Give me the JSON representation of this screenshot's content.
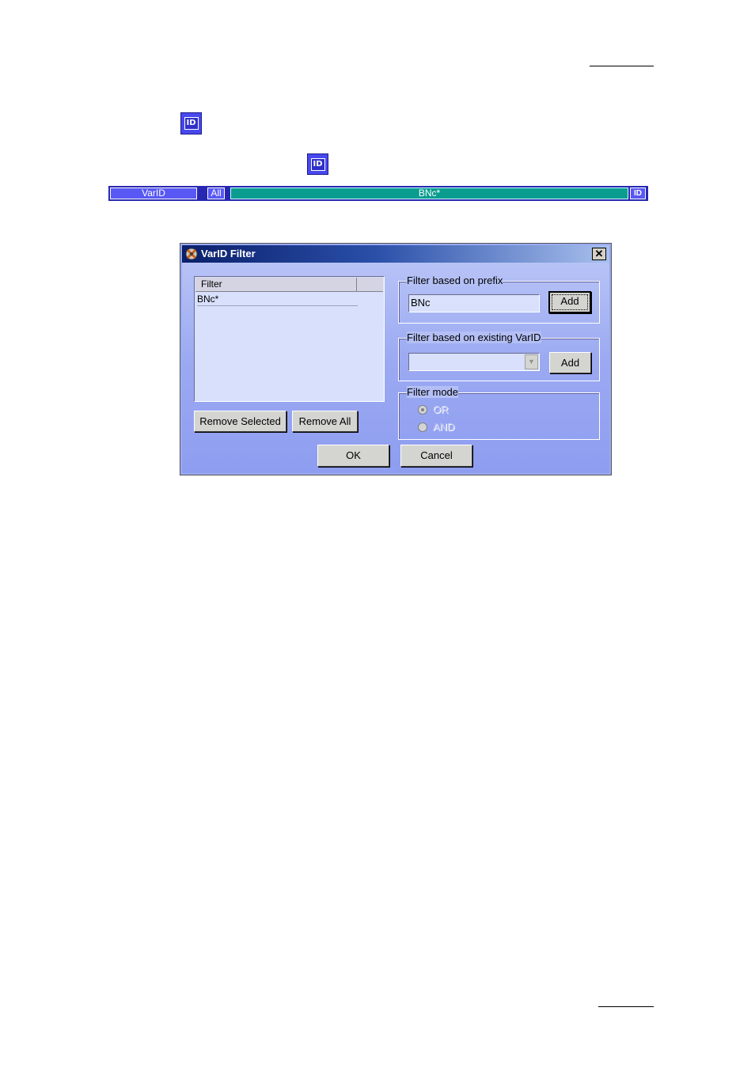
{
  "page": {
    "id_icon_text": "ID"
  },
  "filter_bar": {
    "field_label": "VarID",
    "all_label": "All",
    "value": "BNc*",
    "id_button": "ID",
    "colors": {
      "bar_bg": "#2727b3",
      "label_bg": "#5858f5",
      "value_bg": "#0a9d8f"
    }
  },
  "dialog": {
    "title": "VarID Filter",
    "close_glyph": "✕",
    "list": {
      "column_header": "Filter",
      "rows": [
        "BNc*"
      ]
    },
    "remove_selected_label": "Remove Selected",
    "remove_all_label": "Remove All",
    "prefix_group": {
      "legend": "Filter based on prefix",
      "input_value": "BNc",
      "add_label": "Add"
    },
    "existing_group": {
      "legend": "Filter based on existing VarID",
      "selected_value": "",
      "add_label": "Add"
    },
    "mode_group": {
      "legend": "Filter mode",
      "options": [
        {
          "label": "OR",
          "checked": true
        },
        {
          "label": "AND",
          "checked": false
        }
      ]
    },
    "ok_label": "OK",
    "cancel_label": "Cancel"
  }
}
